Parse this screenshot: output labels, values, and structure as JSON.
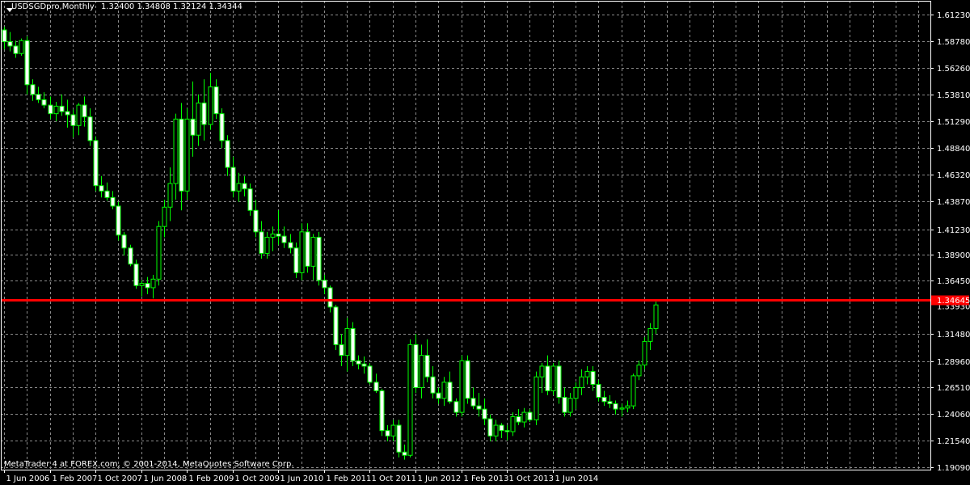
{
  "header": {
    "symbol": "USDSGDpro,Monthly",
    "ohlc": "1.32400 1.34808 1.32124 1.34344"
  },
  "footer": {
    "copyright": "MetaTrader 4 at FOREX.com, © 2001-2014, MetaQuotes Software Corp."
  },
  "colors": {
    "background": "#000000",
    "grid": "#8a8a8a",
    "candle": "#00ff00",
    "bull_fill": "#000000",
    "bear_fill": "#ffffff",
    "price_line": "#ff0000"
  },
  "chart_data": {
    "type": "candlestick",
    "ylim": [
      1.1909,
      1.6123
    ],
    "y_ticks": [
      "1.61230",
      "1.58780",
      "1.56260",
      "1.53810",
      "1.51290",
      "1.48840",
      "1.46320",
      "1.43870",
      "1.41230",
      "1.38900",
      "1.36450",
      "1.31480",
      "1.28960",
      "1.26510",
      "1.24060",
      "1.21540",
      "1.19090"
    ],
    "x_labels": [
      {
        "label": "1 Jun 2006",
        "index": 0
      },
      {
        "label": "1 Feb 2007",
        "index": 8
      },
      {
        "label": "1 Oct 2007",
        "index": 16
      },
      {
        "label": "1 Jun 2008",
        "index": 24
      },
      {
        "label": "1 Feb 2009",
        "index": 32
      },
      {
        "label": "1 Oct 2009",
        "index": 40
      },
      {
        "label": "1 Jun 2010",
        "index": 48
      },
      {
        "label": "1 Feb 2011",
        "index": 56
      },
      {
        "label": "1 Oct 2011",
        "index": 64
      },
      {
        "label": "1 Jun 2012",
        "index": 72
      },
      {
        "label": "1 Feb 2013",
        "index": 80
      },
      {
        "label": "1 Oct 2013",
        "index": 88
      },
      {
        "label": "1 Jun 2014",
        "index": 96
      }
    ],
    "current_price": "1.34645",
    "current_price_value": 1.34645,
    "second_price_label": "1.33930",
    "ohlc": [
      [
        1.598,
        1.601,
        1.58,
        1.587
      ],
      [
        1.587,
        1.596,
        1.578,
        1.583
      ],
      [
        1.583,
        1.588,
        1.572,
        1.576
      ],
      [
        1.576,
        1.59,
        1.574,
        1.588
      ],
      [
        1.588,
        1.592,
        1.538,
        1.547
      ],
      [
        1.547,
        1.552,
        1.532,
        1.538
      ],
      [
        1.538,
        1.545,
        1.53,
        1.533
      ],
      [
        1.533,
        1.54,
        1.525,
        1.528
      ],
      [
        1.528,
        1.536,
        1.515,
        1.52
      ],
      [
        1.52,
        1.531,
        1.513,
        1.527
      ],
      [
        1.527,
        1.538,
        1.518,
        1.522
      ],
      [
        1.522,
        1.533,
        1.507,
        1.519
      ],
      [
        1.519,
        1.524,
        1.498,
        1.509
      ],
      [
        1.509,
        1.53,
        1.5,
        1.528
      ],
      [
        1.528,
        1.536,
        1.508,
        1.517
      ],
      [
        1.517,
        1.525,
        1.49,
        1.495
      ],
      [
        1.495,
        1.499,
        1.448,
        1.453
      ],
      [
        1.453,
        1.462,
        1.442,
        1.448
      ],
      [
        1.448,
        1.456,
        1.439,
        1.442
      ],
      [
        1.442,
        1.448,
        1.431,
        1.434
      ],
      [
        1.434,
        1.438,
        1.402,
        1.407
      ],
      [
        1.407,
        1.41,
        1.388,
        1.395
      ],
      [
        1.395,
        1.398,
        1.378,
        1.38
      ],
      [
        1.38,
        1.384,
        1.357,
        1.36
      ],
      [
        1.36,
        1.365,
        1.35,
        1.362
      ],
      [
        1.362,
        1.368,
        1.352,
        1.358
      ],
      [
        1.358,
        1.37,
        1.348,
        1.366
      ],
      [
        1.366,
        1.42,
        1.36,
        1.415
      ],
      [
        1.415,
        1.44,
        1.405,
        1.433
      ],
      [
        1.433,
        1.47,
        1.42,
        1.455
      ],
      [
        1.455,
        1.52,
        1.44,
        1.515
      ],
      [
        1.515,
        1.53,
        1.43,
        1.448
      ],
      [
        1.448,
        1.525,
        1.44,
        1.515
      ],
      [
        1.515,
        1.55,
        1.48,
        1.5
      ],
      [
        1.5,
        1.538,
        1.49,
        1.53
      ],
      [
        1.53,
        1.552,
        1.495,
        1.51
      ],
      [
        1.51,
        1.558,
        1.505,
        1.545
      ],
      [
        1.545,
        1.552,
        1.515,
        1.52
      ],
      [
        1.52,
        1.525,
        1.488,
        1.495
      ],
      [
        1.495,
        1.5,
        1.462,
        1.47
      ],
      [
        1.47,
        1.48,
        1.442,
        1.448
      ],
      [
        1.448,
        1.465,
        1.438,
        1.455
      ],
      [
        1.455,
        1.462,
        1.443,
        1.45
      ],
      [
        1.45,
        1.455,
        1.425,
        1.43
      ],
      [
        1.43,
        1.44,
        1.405,
        1.41
      ],
      [
        1.41,
        1.42,
        1.385,
        1.39
      ],
      [
        1.39,
        1.41,
        1.385,
        1.405
      ],
      [
        1.405,
        1.415,
        1.392,
        1.408
      ],
      [
        1.408,
        1.43,
        1.398,
        1.406
      ],
      [
        1.406,
        1.415,
        1.395,
        1.4
      ],
      [
        1.4,
        1.408,
        1.39,
        1.395
      ],
      [
        1.395,
        1.4,
        1.367,
        1.372
      ],
      [
        1.372,
        1.418,
        1.365,
        1.41
      ],
      [
        1.41,
        1.418,
        1.372,
        1.378
      ],
      [
        1.378,
        1.408,
        1.365,
        1.405
      ],
      [
        1.405,
        1.41,
        1.36,
        1.365
      ],
      [
        1.365,
        1.37,
        1.352,
        1.358
      ],
      [
        1.358,
        1.36,
        1.335,
        1.34
      ],
      [
        1.34,
        1.342,
        1.3,
        1.305
      ],
      [
        1.305,
        1.315,
        1.285,
        1.295
      ],
      [
        1.295,
        1.33,
        1.28,
        1.32
      ],
      [
        1.32,
        1.326,
        1.285,
        1.29
      ],
      [
        1.29,
        1.295,
        1.282,
        1.287
      ],
      [
        1.287,
        1.294,
        1.278,
        1.285
      ],
      [
        1.285,
        1.288,
        1.268,
        1.27
      ],
      [
        1.27,
        1.278,
        1.26,
        1.262
      ],
      [
        1.262,
        1.264,
        1.22,
        1.225
      ],
      [
        1.225,
        1.23,
        1.215,
        1.22
      ],
      [
        1.22,
        1.235,
        1.215,
        1.23
      ],
      [
        1.23,
        1.235,
        1.2,
        1.205
      ],
      [
        1.205,
        1.212,
        1.198,
        1.202
      ],
      [
        1.202,
        1.31,
        1.2,
        1.305
      ],
      [
        1.305,
        1.315,
        1.26,
        1.265
      ],
      [
        1.265,
        1.305,
        1.255,
        1.295
      ],
      [
        1.295,
        1.31,
        1.27,
        1.275
      ],
      [
        1.275,
        1.285,
        1.255,
        1.26
      ],
      [
        1.26,
        1.265,
        1.25,
        1.255
      ],
      [
        1.255,
        1.275,
        1.248,
        1.27
      ],
      [
        1.27,
        1.28,
        1.25,
        1.252
      ],
      [
        1.252,
        1.255,
        1.238,
        1.242
      ],
      [
        1.242,
        1.295,
        1.238,
        1.29
      ],
      [
        1.29,
        1.295,
        1.25,
        1.255
      ],
      [
        1.255,
        1.265,
        1.245,
        1.248
      ],
      [
        1.248,
        1.26,
        1.238,
        1.245
      ],
      [
        1.245,
        1.255,
        1.23,
        1.236
      ],
      [
        1.236,
        1.24,
        1.215,
        1.22
      ],
      [
        1.22,
        1.235,
        1.215,
        1.23
      ],
      [
        1.23,
        1.232,
        1.218,
        1.225
      ],
      [
        1.225,
        1.23,
        1.216,
        1.224
      ],
      [
        1.224,
        1.242,
        1.22,
        1.238
      ],
      [
        1.238,
        1.245,
        1.23,
        1.233
      ],
      [
        1.233,
        1.246,
        1.228,
        1.242
      ],
      [
        1.242,
        1.245,
        1.233,
        1.235
      ],
      [
        1.235,
        1.28,
        1.23,
        1.275
      ],
      [
        1.275,
        1.288,
        1.26,
        1.285
      ],
      [
        1.285,
        1.295,
        1.258,
        1.262
      ],
      [
        1.262,
        1.288,
        1.258,
        1.285
      ],
      [
        1.285,
        1.29,
        1.25,
        1.256
      ],
      [
        1.256,
        1.265,
        1.238,
        1.242
      ],
      [
        1.242,
        1.26,
        1.238,
        1.255
      ],
      [
        1.255,
        1.27,
        1.245,
        1.265
      ],
      [
        1.265,
        1.282,
        1.258,
        1.275
      ],
      [
        1.275,
        1.285,
        1.268,
        1.28
      ],
      [
        1.28,
        1.285,
        1.262,
        1.268
      ],
      [
        1.268,
        1.272,
        1.252,
        1.256
      ],
      [
        1.256,
        1.262,
        1.248,
        1.252
      ],
      [
        1.252,
        1.258,
        1.246,
        1.25
      ],
      [
        1.25,
        1.253,
        1.24,
        1.245
      ],
      [
        1.245,
        1.25,
        1.238,
        1.246
      ],
      [
        1.246,
        1.253,
        1.242,
        1.248
      ],
      [
        1.248,
        1.278,
        1.245,
        1.276
      ],
      [
        1.276,
        1.29,
        1.272,
        1.286
      ],
      [
        1.286,
        1.312,
        1.282,
        1.308
      ],
      [
        1.308,
        1.325,
        1.3,
        1.32
      ],
      [
        1.32,
        1.345,
        1.315,
        1.342
      ]
    ]
  }
}
